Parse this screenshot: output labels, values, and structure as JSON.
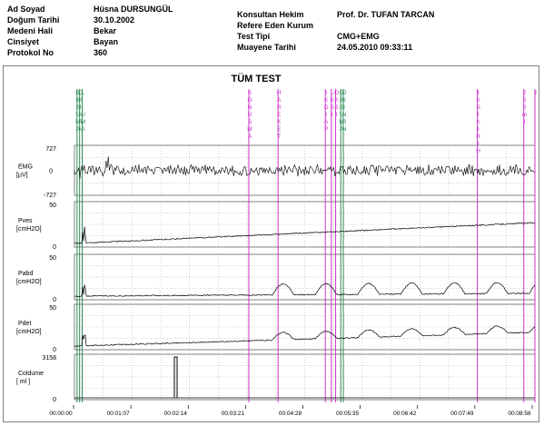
{
  "patient": {
    "fields": [
      {
        "label": "Ad Soyad",
        "value": "Hüsna DURSUNGÜL"
      },
      {
        "label": "Doğum Tarihi",
        "value": "30.10.2002"
      },
      {
        "label": "Medeni Hali",
        "value": "Bekar"
      },
      {
        "label": "Cinsiyet",
        "value": "Bayan"
      },
      {
        "label": "Protokol No",
        "value": "360"
      }
    ]
  },
  "exam": {
    "fields": [
      {
        "label": "Konsultan Hekim",
        "value": "Prof. Dr. TUFAN TARCAN"
      },
      {
        "label": "Refere Eden Kurum",
        "value": ""
      },
      {
        "label": "Test Tipi",
        "value": "CMG+EMG"
      },
      {
        "label": "Muayene Tarihi",
        "value": "24.05.2010 09:33:11"
      }
    ]
  },
  "chart_title": "TÜM TEST",
  "channels": [
    {
      "name": "EMG",
      "unit": "[µV]",
      "max": "727",
      "mid": "0",
      "min": "-727"
    },
    {
      "name": "Pves",
      "unit": "[cmH2O]",
      "max": "50",
      "min": "0"
    },
    {
      "name": "Pabd",
      "unit": "[cmH2O]",
      "max": "50",
      "min": "0"
    },
    {
      "name": "Pdet",
      "unit": "[cmH2O]",
      "max": "50",
      "min": "0"
    },
    {
      "name": "Coldume",
      "unit": "[ ml ]",
      "max": "3158",
      "min": "0"
    }
  ],
  "time_axis": [
    "00:00:00",
    "00:01:07",
    "00:02:14",
    "00:03:21",
    "00:04:28",
    "00:05:35",
    "00:06:42",
    "00:07:49",
    "00:08:56"
  ],
  "markers": [
    {
      "color": "#2e8b57",
      "x_time": "00:00:03",
      "text": "DBSUMA"
    },
    {
      "color": "#2e8b57",
      "x_time": "00:00:06",
      "text": "OKINRN"
    },
    {
      "color": "#2e8b57",
      "x_time": "00:00:09",
      "text": "L  UMA"
    },
    {
      "color": "#cc33cc",
      "x_time": "00:03:23",
      "text": "KONUSMA"
    },
    {
      "color": "#cc33cc",
      "x_time": "00:03:57",
      "text": "HAREKET"
    },
    {
      "color": "#cc33cc",
      "x_time": "00:04:52",
      "text": "IKDIAP"
    },
    {
      "color": "#cc33cc",
      "x_time": "00:04:59",
      "text": "LKSI"
    },
    {
      "color": "#cc33cc",
      "x_time": "00:05:04",
      "text": "OKSI"
    },
    {
      "color": "#2e8b57",
      "x_time": "00:05:10",
      "text": "DBSUMA"
    },
    {
      "color": "#2e8b57",
      "x_time": "00:05:13",
      "text": "OKINRN"
    },
    {
      "color": "#cc33cc",
      "x_time": "00:07:49",
      "text": "IKSIKIRIH"
    },
    {
      "color": "#cc33cc",
      "x_time": "00:08:43",
      "text": "200ml"
    },
    {
      "color": "#cc33cc",
      "x_time": "00:08:56",
      "text": "I"
    }
  ],
  "colors": {
    "marker_green": "#2e8b57",
    "marker_magenta": "#cc33cc",
    "trace": "#000000",
    "grid": "#a0a0a0"
  }
}
